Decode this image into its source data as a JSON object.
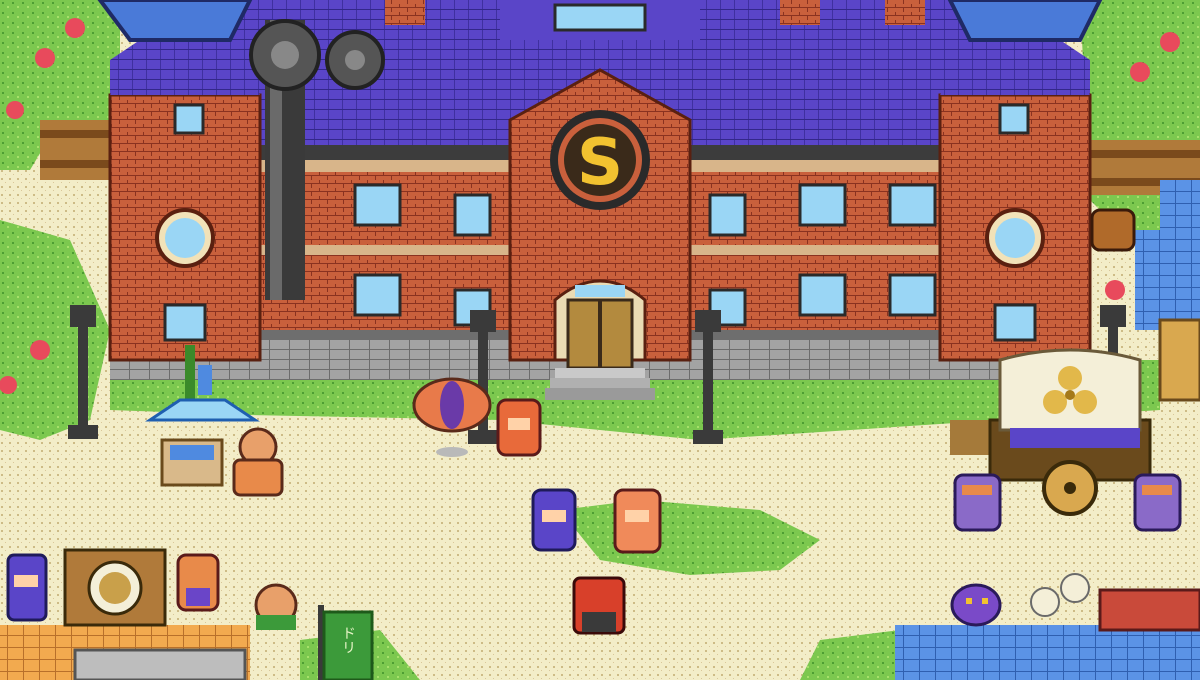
{
  "scene": {
    "building_emblem": "S",
    "banner_text": "ドリ",
    "cart_emblem": "trefoil-flower-icon"
  },
  "colors": {
    "grass": "#6fc24a",
    "grass_dark": "#3f8f2a",
    "path": "#f3edc8",
    "roof": "#5a45c8",
    "roof_dark": "#33278a",
    "brick": "#c9603c",
    "brick_dark": "#8a3220",
    "stone": "#9a9a9a",
    "window": "#9ad6f5",
    "door": "#b38a3e",
    "emblem_gold": "#f2c230",
    "awning_orange": "#f0a64a",
    "awning_blue": "#4f8ae0",
    "flower": "#e84a5c"
  }
}
